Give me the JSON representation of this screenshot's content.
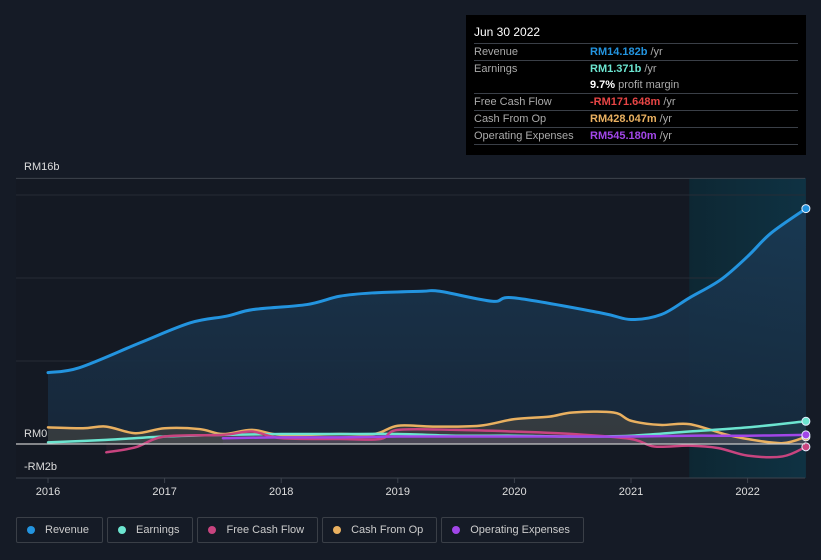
{
  "tooltip": {
    "date": "Jun 30 2022",
    "rows": [
      {
        "label": "Revenue",
        "value": "RM14.182b",
        "unit": "/yr",
        "color": "#2394df"
      },
      {
        "label": "Earnings",
        "value": "RM1.371b",
        "unit": "/yr",
        "color": "#6ce5d0"
      },
      {
        "label": "",
        "value": "9.7%",
        "unit": "profit margin",
        "color": "#ffffff"
      },
      {
        "label": "Free Cash Flow",
        "value": "-RM171.648m",
        "unit": "/yr",
        "color": "#e84545"
      },
      {
        "label": "Cash From Op",
        "value": "RM428.047m",
        "unit": "/yr",
        "color": "#e9b060"
      },
      {
        "label": "Operating Expenses",
        "value": "RM545.180m",
        "unit": "/yr",
        "color": "#a146e8"
      }
    ]
  },
  "chart_data": {
    "type": "line",
    "title": "",
    "xlabel": "",
    "ylabel": "",
    "y_tick_labels": [
      "RM16b",
      "RM0",
      "-RM2b"
    ],
    "x_tick_labels": [
      "2016",
      "2017",
      "2018",
      "2019",
      "2020",
      "2021",
      "2022"
    ],
    "xlim": [
      2015.72,
      2022.5
    ],
    "ylim": [
      -2,
      16
    ],
    "gridlines_b": [
      5,
      10,
      15,
      16
    ],
    "forecast_shade_from": 2021.5,
    "legend_position": "bottom",
    "series": [
      {
        "name": "Revenue",
        "color": "#2394df",
        "area": true,
        "x": [
          2016.0,
          2016.27,
          2016.79,
          2017.22,
          2017.53,
          2017.76,
          2018.22,
          2018.5,
          2018.78,
          2019.21,
          2019.36,
          2019.81,
          2020.0,
          2020.74,
          2021.0,
          2021.26,
          2021.5,
          2021.77,
          2022.0,
          2022.2,
          2022.5
        ],
        "values": [
          4.3,
          4.6,
          6.1,
          7.3,
          7.7,
          8.1,
          8.4,
          8.9,
          9.1,
          9.2,
          9.2,
          8.6,
          8.8,
          7.9,
          7.5,
          7.8,
          8.8,
          9.9,
          11.3,
          12.7,
          14.18
        ]
      },
      {
        "name": "Earnings",
        "color": "#6ce5d0",
        "x": [
          2016.0,
          2016.5,
          2017.0,
          2017.5,
          2018.0,
          2018.5,
          2019.0,
          2019.5,
          2020.0,
          2020.5,
          2021.0,
          2021.5,
          2022.0,
          2022.5
        ],
        "values": [
          0.1,
          0.25,
          0.45,
          0.55,
          0.6,
          0.6,
          0.6,
          0.5,
          0.5,
          0.45,
          0.5,
          0.75,
          1.0,
          1.37
        ]
      },
      {
        "name": "Free Cash Flow",
        "color": "#c8447f",
        "x": [
          2016.5,
          2016.75,
          2017.0,
          2017.5,
          2017.75,
          2018.0,
          2018.5,
          2018.85,
          2019.0,
          2019.5,
          2020.0,
          2020.5,
          2021.0,
          2021.2,
          2021.5,
          2021.75,
          2022.0,
          2022.3,
          2022.5
        ],
        "values": [
          -0.5,
          -0.2,
          0.45,
          0.55,
          0.75,
          0.35,
          0.3,
          0.3,
          0.85,
          0.85,
          0.75,
          0.6,
          0.3,
          -0.15,
          -0.1,
          -0.25,
          -0.7,
          -0.75,
          -0.17
        ]
      },
      {
        "name": "Cash From Op",
        "color": "#e9b060",
        "area": true,
        "x": [
          2016.0,
          2016.3,
          2016.5,
          2016.75,
          2017.0,
          2017.3,
          2017.5,
          2017.75,
          2018.0,
          2018.5,
          2018.8,
          2019.0,
          2019.3,
          2019.7,
          2020.0,
          2020.3,
          2020.5,
          2020.85,
          2021.0,
          2021.25,
          2021.5,
          2021.8,
          2022.0,
          2022.3,
          2022.5
        ],
        "values": [
          1.0,
          0.95,
          1.05,
          0.65,
          0.95,
          0.9,
          0.6,
          0.85,
          0.55,
          0.6,
          0.6,
          1.1,
          1.05,
          1.1,
          1.5,
          1.65,
          1.9,
          1.9,
          1.4,
          1.15,
          1.2,
          0.6,
          0.3,
          0.05,
          0.43
        ]
      },
      {
        "name": "Operating Expenses",
        "color": "#a146e8",
        "x": [
          2017.5,
          2018.0,
          2018.5,
          2019.0,
          2019.5,
          2020.0,
          2020.5,
          2021.0,
          2021.5,
          2022.0,
          2022.5
        ],
        "values": [
          0.35,
          0.4,
          0.4,
          0.45,
          0.45,
          0.45,
          0.45,
          0.45,
          0.5,
          0.5,
          0.55
        ]
      }
    ]
  },
  "legend": {
    "items": [
      {
        "label": "Revenue",
        "color": "#2394df"
      },
      {
        "label": "Earnings",
        "color": "#6ce5d0"
      },
      {
        "label": "Free Cash Flow",
        "color": "#c8447f"
      },
      {
        "label": "Cash From Op",
        "color": "#e9b060"
      },
      {
        "label": "Operating Expenses",
        "color": "#a146e8"
      }
    ]
  }
}
